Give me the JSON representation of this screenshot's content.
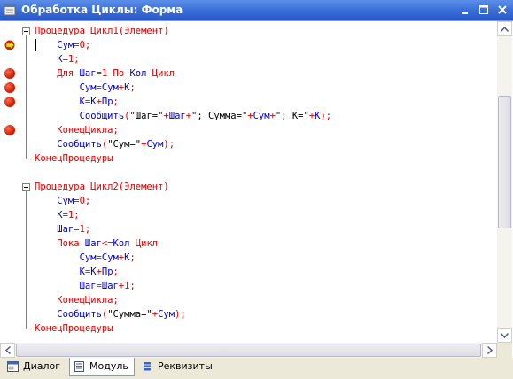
{
  "window": {
    "title": "Обработка Циклы: Форма"
  },
  "code_lines": [
    [
      {
        "t": "Процедура Цикл1",
        "c": "kw"
      },
      {
        "t": "(Элемент)",
        "c": "op"
      }
    ],
    [
      {
        "t": "    Сум",
        "c": "id"
      },
      {
        "t": "=0;",
        "c": "op"
      }
    ],
    [
      {
        "t": "    К",
        "c": "id"
      },
      {
        "t": "=1;",
        "c": "op"
      }
    ],
    [
      {
        "t": "    Для ",
        "c": "kw"
      },
      {
        "t": "Шаг",
        "c": "id"
      },
      {
        "t": "=1 ",
        "c": "op"
      },
      {
        "t": "По ",
        "c": "kw"
      },
      {
        "t": "Кол ",
        "c": "id"
      },
      {
        "t": "Цикл",
        "c": "kw"
      }
    ],
    [
      {
        "t": "        Сум",
        "c": "id"
      },
      {
        "t": "=",
        "c": "op"
      },
      {
        "t": "Сум",
        "c": "id"
      },
      {
        "t": "+",
        "c": "op"
      },
      {
        "t": "К",
        "c": "id"
      },
      {
        "t": ";",
        "c": "op"
      }
    ],
    [
      {
        "t": "        К",
        "c": "id"
      },
      {
        "t": "=",
        "c": "op"
      },
      {
        "t": "К",
        "c": "id"
      },
      {
        "t": "+",
        "c": "op"
      },
      {
        "t": "Пр",
        "c": "id"
      },
      {
        "t": ";",
        "c": "op"
      }
    ],
    [
      {
        "t": "        Сообщить",
        "c": "id"
      },
      {
        "t": "(",
        "c": "op"
      },
      {
        "t": "\"Шаг=\"",
        "c": "str"
      },
      {
        "t": "+",
        "c": "op"
      },
      {
        "t": "Шаг",
        "c": "id"
      },
      {
        "t": "+",
        "c": "op"
      },
      {
        "t": "\"; Сумма=\"",
        "c": "str"
      },
      {
        "t": "+",
        "c": "op"
      },
      {
        "t": "Сум",
        "c": "id"
      },
      {
        "t": "+",
        "c": "op"
      },
      {
        "t": "\"; К=\"",
        "c": "str"
      },
      {
        "t": "+",
        "c": "op"
      },
      {
        "t": "К",
        "c": "id"
      },
      {
        "t": ");",
        "c": "op"
      }
    ],
    [
      {
        "t": "    КонецЦикла",
        "c": "kw"
      },
      {
        "t": ";",
        "c": "op"
      }
    ],
    [
      {
        "t": "    Сообщить",
        "c": "id"
      },
      {
        "t": "(",
        "c": "op"
      },
      {
        "t": "\"Сум=\"",
        "c": "str"
      },
      {
        "t": "+",
        "c": "op"
      },
      {
        "t": "Сум",
        "c": "id"
      },
      {
        "t": ");",
        "c": "op"
      }
    ],
    [
      {
        "t": "КонецПроцедуры",
        "c": "kw"
      }
    ],
    [],
    [
      {
        "t": "Процедура Цикл2",
        "c": "kw"
      },
      {
        "t": "(Элемент)",
        "c": "op"
      }
    ],
    [
      {
        "t": "    Сум",
        "c": "id"
      },
      {
        "t": "=0;",
        "c": "op"
      }
    ],
    [
      {
        "t": "    К",
        "c": "id"
      },
      {
        "t": "=1;",
        "c": "op"
      }
    ],
    [
      {
        "t": "    Шаг",
        "c": "id"
      },
      {
        "t": "=1;",
        "c": "op"
      }
    ],
    [
      {
        "t": "    Пока ",
        "c": "kw"
      },
      {
        "t": "Шаг",
        "c": "id"
      },
      {
        "t": "<=",
        "c": "op"
      },
      {
        "t": "Кол ",
        "c": "id"
      },
      {
        "t": "Цикл",
        "c": "kw"
      }
    ],
    [
      {
        "t": "        Сум",
        "c": "id"
      },
      {
        "t": "=",
        "c": "op"
      },
      {
        "t": "Сум",
        "c": "id"
      },
      {
        "t": "+",
        "c": "op"
      },
      {
        "t": "К",
        "c": "id"
      },
      {
        "t": ";",
        "c": "op"
      }
    ],
    [
      {
        "t": "        К",
        "c": "id"
      },
      {
        "t": "=",
        "c": "op"
      },
      {
        "t": "К",
        "c": "id"
      },
      {
        "t": "+",
        "c": "op"
      },
      {
        "t": "Пр",
        "c": "id"
      },
      {
        "t": ";",
        "c": "op"
      }
    ],
    [
      {
        "t": "        Шаг",
        "c": "id"
      },
      {
        "t": "=",
        "c": "op"
      },
      {
        "t": "Шаг",
        "c": "id"
      },
      {
        "t": "+1;",
        "c": "op"
      }
    ],
    [
      {
        "t": "    КонецЦикла",
        "c": "kw"
      },
      {
        "t": ";",
        "c": "op"
      }
    ],
    [
      {
        "t": "    Сообщить",
        "c": "id"
      },
      {
        "t": "(",
        "c": "op"
      },
      {
        "t": "\"Сумма=\"",
        "c": "str"
      },
      {
        "t": "+",
        "c": "op"
      },
      {
        "t": "Сум",
        "c": "id"
      },
      {
        "t": ");",
        "c": "op"
      }
    ],
    [
      {
        "t": "КонецПроцедуры",
        "c": "kw"
      }
    ]
  ],
  "breakpoint_lines": [
    4,
    5,
    6,
    8
  ],
  "current_line": 2,
  "colors": {
    "keyword": "#e00000",
    "identifier": "#0000c8",
    "title_bar": "#2858c8",
    "breakpoint": "#d02000"
  },
  "tabs": [
    {
      "label": "Диалог",
      "icon": "dialog-icon",
      "active": false
    },
    {
      "label": "Модуль",
      "icon": "module-icon",
      "active": true
    },
    {
      "label": "Реквизиты",
      "icon": "attributes-icon",
      "active": false
    }
  ]
}
